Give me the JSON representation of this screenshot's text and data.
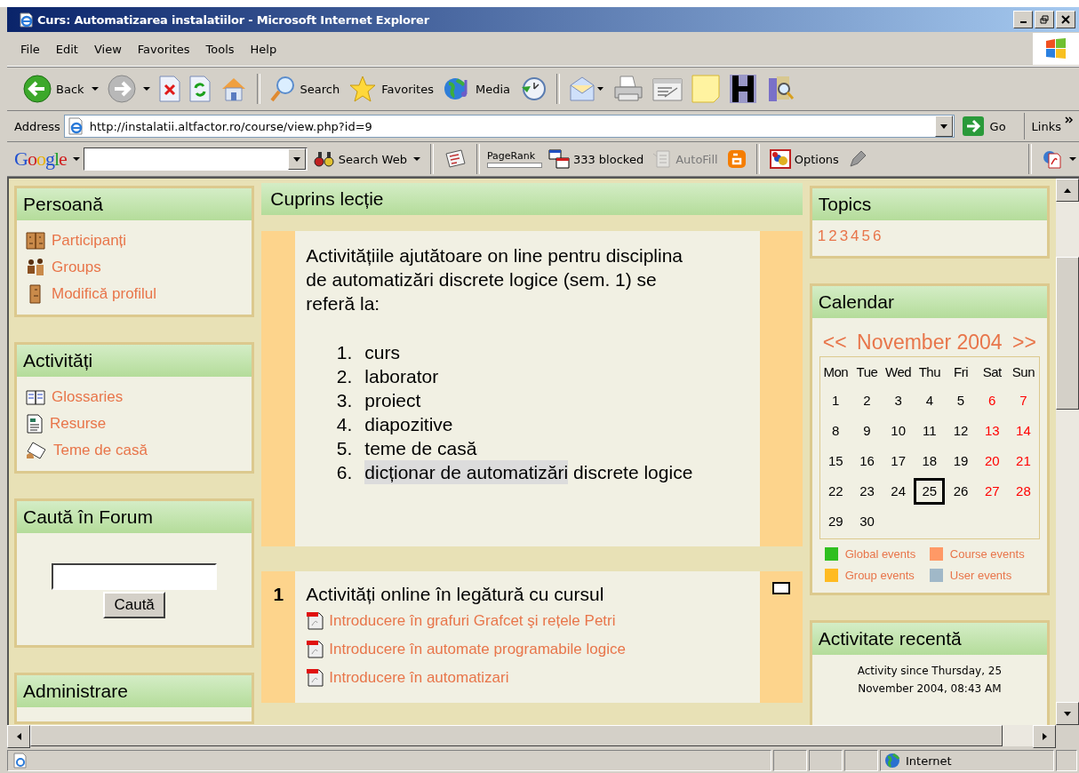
{
  "window": {
    "title": "Curs: Automatizarea instalatiilor - Microsoft Internet Explorer"
  },
  "menu": [
    "File",
    "Edit",
    "View",
    "Favorites",
    "Tools",
    "Help"
  ],
  "toolbar": [
    {
      "kind": "back",
      "label": "Back"
    },
    {
      "kind": "forward"
    },
    {
      "kind": "stop"
    },
    {
      "kind": "refresh"
    },
    {
      "kind": "home"
    },
    {
      "kind": "search",
      "label": "Search"
    },
    {
      "kind": "favorites",
      "label": "Favorites"
    },
    {
      "kind": "media",
      "label": "Media"
    },
    {
      "kind": "history"
    },
    {
      "kind": "mail"
    },
    {
      "kind": "print"
    },
    {
      "kind": "edit"
    },
    {
      "kind": "note"
    },
    {
      "kind": "hbox"
    },
    {
      "kind": "research"
    }
  ],
  "address": {
    "label": "Address",
    "url": "http://instalatii.altfactor.ro/course/view.php?id=9",
    "go": "Go",
    "links": "Links"
  },
  "google_logo": "Google",
  "google_toolbar": [
    {
      "kind": "searchweb",
      "label": "Search Web",
      "disabled": false
    },
    {
      "kind": "news",
      "disabled": false
    },
    {
      "kind": "pagerank",
      "label": "PageRank",
      "disabled": false
    },
    {
      "kind": "blocked",
      "label": "333 blocked",
      "disabled": false
    },
    {
      "kind": "autofill",
      "label": "AutoFill",
      "disabled": true
    },
    {
      "kind": "blogger",
      "disabled": false
    },
    {
      "kind": "options",
      "label": "Options",
      "disabled": false
    },
    {
      "kind": "pen",
      "disabled": false
    }
  ],
  "left_blocks": [
    {
      "title": "Persoană",
      "kind": "links",
      "items": [
        {
          "kind": "people",
          "label": "Participanți"
        },
        {
          "kind": "groups",
          "label": "Groups"
        },
        {
          "kind": "person",
          "label": "Modifică profilul"
        }
      ]
    },
    {
      "title": "Activități",
      "kind": "links",
      "items": [
        {
          "kind": "glossary",
          "label": "Glossaries"
        },
        {
          "kind": "resource",
          "label": "Resurse"
        },
        {
          "kind": "assignment",
          "label": "Teme de casă"
        }
      ]
    },
    {
      "title": "Caută în Forum",
      "kind": "search",
      "button": "Caută"
    },
    {
      "title": "Administrare",
      "kind": "links"
    }
  ],
  "summary": {
    "title": "Cuprins lecție",
    "intro": "Activitățiile ajutătoare on line pentru disciplina de automatizări discrete logice (sem. 1) se referă la:",
    "list": [
      {
        "number": "1.",
        "parts": [
          {
            "text": "curs",
            "highlighted": false
          }
        ]
      },
      {
        "number": "2.",
        "parts": [
          {
            "text": "laborator",
            "highlighted": false
          }
        ]
      },
      {
        "number": "3.",
        "parts": [
          {
            "text": "proiect",
            "highlighted": false
          }
        ]
      },
      {
        "number": "4.",
        "parts": [
          {
            "text": "diapozitive",
            "highlighted": false
          }
        ]
      },
      {
        "number": "5.",
        "parts": [
          {
            "text": "teme de casă",
            "highlighted": false
          }
        ]
      },
      {
        "number": "6.",
        "parts": [
          {
            "text": "dicționar de automatizări",
            "highlighted": true
          },
          {
            "text": "discrete logice",
            "highlighted": false
          }
        ]
      }
    ]
  },
  "sections": [
    {
      "number": "1",
      "title": "Activități online în legătură cu cursul",
      "links": [
        "Introducere în grafuri Grafcet şi rețele Petri",
        "Introducere în automate programabile logice",
        "Introducere în automatizari"
      ]
    }
  ],
  "topics": {
    "title": "Topics",
    "links": [
      "1",
      "2",
      "3",
      "4",
      "5",
      "6"
    ]
  },
  "calendar": {
    "title": "Calendar",
    "prev": "<<",
    "month": "November 2004",
    "next": ">>",
    "weekdays": [
      "Mon",
      "Tue",
      "Wed",
      "Thu",
      "Fri",
      "Sat",
      "Sun"
    ],
    "weeks": [
      [
        {
          "day": "1",
          "weekend": false,
          "today": false
        },
        {
          "day": "2",
          "weekend": false,
          "today": false
        },
        {
          "day": "3",
          "weekend": false,
          "today": false
        },
        {
          "day": "4",
          "weekend": false,
          "today": false
        },
        {
          "day": "5",
          "weekend": false,
          "today": false
        },
        {
          "day": "6",
          "weekend": true,
          "today": false
        },
        {
          "day": "7",
          "weekend": true,
          "today": false
        }
      ],
      [
        {
          "day": "8",
          "weekend": false,
          "today": false
        },
        {
          "day": "9",
          "weekend": false,
          "today": false
        },
        {
          "day": "10",
          "weekend": false,
          "today": false
        },
        {
          "day": "11",
          "weekend": false,
          "today": false
        },
        {
          "day": "12",
          "weekend": false,
          "today": false
        },
        {
          "day": "13",
          "weekend": true,
          "today": false
        },
        {
          "day": "14",
          "weekend": true,
          "today": false
        }
      ],
      [
        {
          "day": "15",
          "weekend": false,
          "today": false
        },
        {
          "day": "16",
          "weekend": false,
          "today": false
        },
        {
          "day": "17",
          "weekend": false,
          "today": false
        },
        {
          "day": "18",
          "weekend": false,
          "today": false
        },
        {
          "day": "19",
          "weekend": false,
          "today": false
        },
        {
          "day": "20",
          "weekend": true,
          "today": false
        },
        {
          "day": "21",
          "weekend": true,
          "today": false
        }
      ],
      [
        {
          "day": "22",
          "weekend": false,
          "today": false
        },
        {
          "day": "23",
          "weekend": false,
          "today": false
        },
        {
          "day": "24",
          "weekend": false,
          "today": false
        },
        {
          "day": "25",
          "weekend": false,
          "today": true
        },
        {
          "day": "26",
          "weekend": false,
          "today": false
        },
        {
          "day": "27",
          "weekend": true,
          "today": false
        },
        {
          "day": "28",
          "weekend": true,
          "today": false
        }
      ],
      [
        {
          "day": "29",
          "weekend": false,
          "today": false
        },
        {
          "day": "30",
          "weekend": false,
          "today": false
        }
      ]
    ],
    "legend": [
      {
        "label": "Global events",
        "color": "#2fbf1f"
      },
      {
        "label": "Course events",
        "color": "#ff9966"
      },
      {
        "label": "Group events",
        "color": "#ffbb22"
      },
      {
        "label": "User events",
        "color": "#a0b8c8"
      }
    ]
  },
  "recent": {
    "title": "Activitate recentă",
    "text": "Activity since Thursday, 25 November 2004, 08:43 AM"
  },
  "status_bar": {
    "zone": "Internet"
  }
}
